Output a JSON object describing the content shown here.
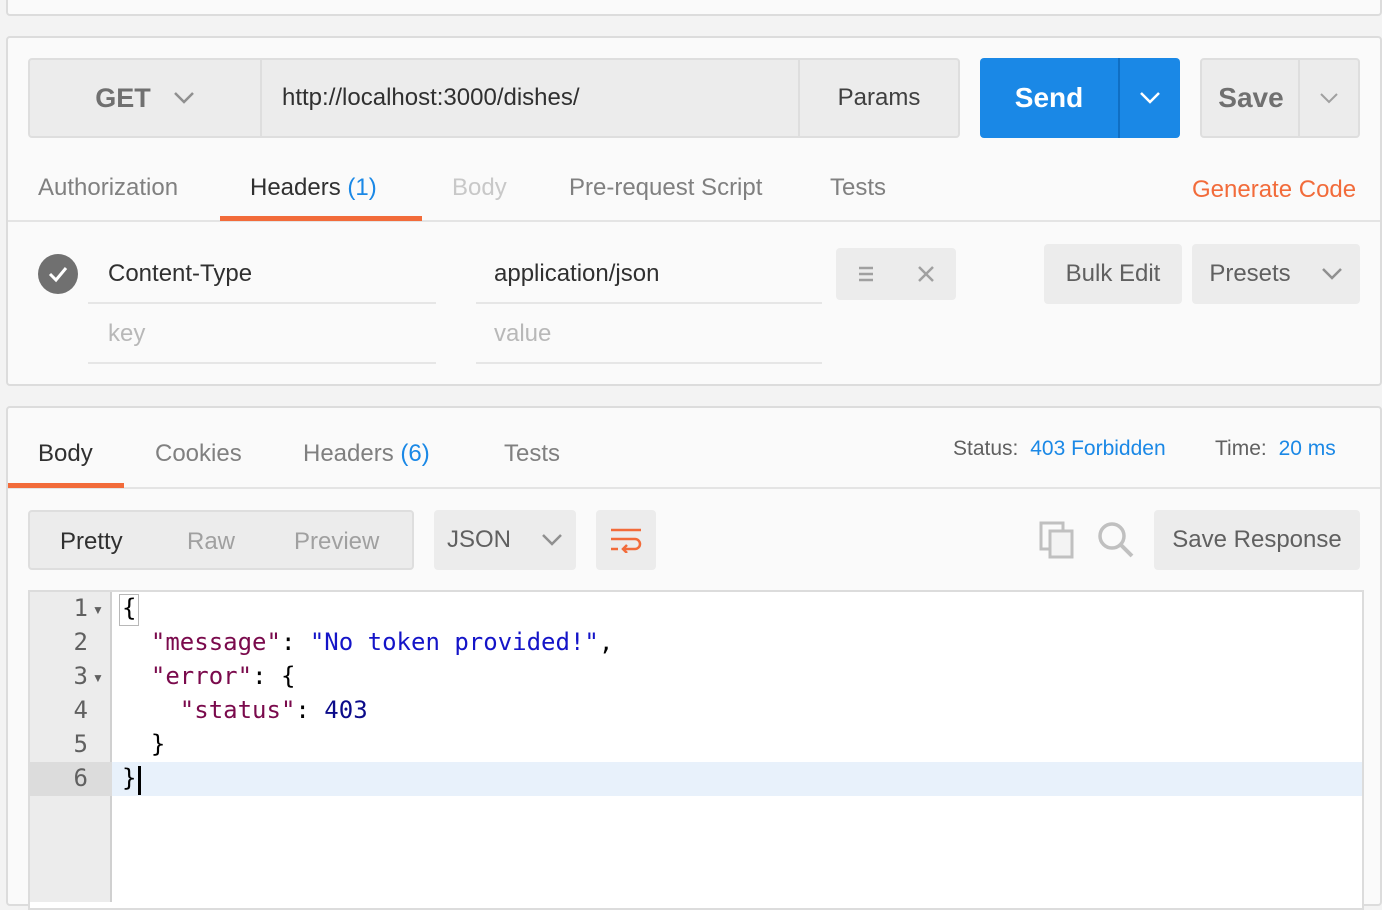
{
  "request": {
    "method": "GET",
    "url": "http://localhost:3000/dishes/",
    "params_label": "Params",
    "send_label": "Send",
    "save_label": "Save",
    "tabs": [
      {
        "label": "Authorization",
        "count": ""
      },
      {
        "label": "Headers",
        "count": "(1)"
      },
      {
        "label": "Body",
        "count": ""
      },
      {
        "label": "Pre-request Script",
        "count": ""
      },
      {
        "label": "Tests",
        "count": ""
      }
    ],
    "generate_code": "Generate Code",
    "headers": [
      {
        "key": "Content-Type",
        "value": "application/json"
      }
    ],
    "key_placeholder": "key",
    "value_placeholder": "value",
    "bulk_edit_label": "Bulk Edit",
    "presets_label": "Presets"
  },
  "response": {
    "tabs": [
      {
        "label": "Body",
        "count": ""
      },
      {
        "label": "Cookies",
        "count": ""
      },
      {
        "label": "Headers",
        "count": "(6)"
      },
      {
        "label": "Tests",
        "count": ""
      }
    ],
    "status_label": "Status:",
    "status_value": "403 Forbidden",
    "time_label": "Time:",
    "time_value": "20 ms",
    "view_modes": [
      "Pretty",
      "Raw",
      "Preview"
    ],
    "format": "JSON",
    "save_response_label": "Save Response",
    "line_numbers": [
      "1",
      "2",
      "3",
      "4",
      "5",
      "6"
    ],
    "code": {
      "open_brace": "{",
      "message_key": "\"message\"",
      "message_value": "\"No token provided!\"",
      "error_key": "\"error\"",
      "status_key": "\"status\"",
      "status_value": "403",
      "inner_close": "}",
      "outer_close": "}"
    }
  },
  "colors": {
    "accent_blue": "#1a88e6",
    "accent_orange": "#f26b3a"
  },
  "icons": [
    "chevron-down-icon",
    "check-icon",
    "menu-icon",
    "close-icon",
    "wrap-lines-icon",
    "copy-icon",
    "search-icon",
    "fold-arrow-icon"
  ]
}
